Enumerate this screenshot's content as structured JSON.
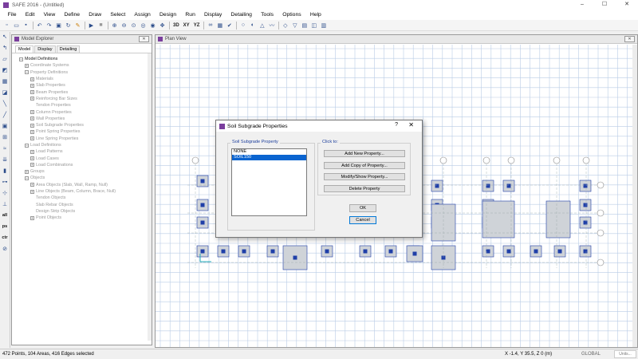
{
  "window": {
    "title": "SAFE 2016 - (Untitled)",
    "controls": [
      "–",
      "☐",
      "✕"
    ]
  },
  "menu": [
    "File",
    "Edit",
    "View",
    "Define",
    "Draw",
    "Select",
    "Assign",
    "Design",
    "Run",
    "Display",
    "Detailing",
    "Tools",
    "Options",
    "Help"
  ],
  "toolbar": {
    "icons": [
      "new-file-icon",
      "open-folder-icon",
      "save-icon",
      "undo-icon",
      "redo-icon",
      "lock-icon",
      "refresh-icon",
      "pencil-icon",
      "run-icon",
      "stop-icon",
      "zoom-in-icon",
      "zoom-out-icon",
      "zoom-window-icon",
      "zoom-prev-icon",
      "zoom-fit-icon",
      "pan-icon",
      "move-icon",
      "binoculars-icon",
      "view-icon",
      "check-icon",
      "circle-icon",
      "rotate-icon",
      "warning-icon",
      "deformed-icon",
      "shape-icon",
      "filter-icon",
      "grid-icon",
      "reset-icon",
      "table-icon"
    ],
    "view_labels": [
      "3D",
      "XY",
      "YZ"
    ]
  },
  "left_tools": [
    "pointer",
    "reshape",
    "area",
    "slab",
    "drop-panel",
    "opening",
    "beam",
    "line",
    "column",
    "point",
    "spring",
    "load",
    "wall",
    "design-strip",
    "zoom",
    "all",
    "ps",
    "ctr",
    "clear"
  ],
  "left_tool_labels": {
    "all": "all",
    "ps": "ps",
    "ctr": "ctr"
  },
  "explorer": {
    "title": "Model Explorer",
    "tabs": [
      "Model",
      "Display",
      "Detailing"
    ],
    "tree": [
      {
        "label": "Model Definitions",
        "level": 0,
        "exp": "−",
        "strong": true
      },
      {
        "label": "Coordinate Systems",
        "level": 1,
        "exp": "+"
      },
      {
        "label": "Property Definitions",
        "level": 1,
        "exp": "−"
      },
      {
        "label": "Materials",
        "level": 2,
        "exp": "+"
      },
      {
        "label": "Slab Properties",
        "level": 2,
        "exp": "+"
      },
      {
        "label": "Beam Properties",
        "level": 2,
        "exp": "+"
      },
      {
        "label": "Reinforcing Bar Sizes",
        "level": 2,
        "exp": "+"
      },
      {
        "label": "Tendon Properties",
        "level": 2,
        "exp": ""
      },
      {
        "label": "Column Properties",
        "level": 2,
        "exp": "+"
      },
      {
        "label": "Wall Properties",
        "level": 2,
        "exp": "+"
      },
      {
        "label": "Soil Subgrade Properties",
        "level": 2,
        "exp": "+"
      },
      {
        "label": "Point Spring Properties",
        "level": 2,
        "exp": "+"
      },
      {
        "label": "Line Spring Properties",
        "level": 2,
        "exp": "+"
      },
      {
        "label": "Load Definitions",
        "level": 1,
        "exp": "−"
      },
      {
        "label": "Load Patterns",
        "level": 2,
        "exp": "+"
      },
      {
        "label": "Load Cases",
        "level": 2,
        "exp": "+"
      },
      {
        "label": "Load Combinations",
        "level": 2,
        "exp": "+"
      },
      {
        "label": "Groups",
        "level": 1,
        "exp": "+"
      },
      {
        "label": "Objects",
        "level": 1,
        "exp": "−"
      },
      {
        "label": "Area Objects (Slab, Wall, Ramp, Null)",
        "level": 2,
        "exp": "+"
      },
      {
        "label": "Line Objects (Beam, Column, Brace, Null)",
        "level": 2,
        "exp": "+"
      },
      {
        "label": "Tendon Objects",
        "level": 2,
        "exp": ""
      },
      {
        "label": "Slab Rebar Objects",
        "level": 2,
        "exp": ""
      },
      {
        "label": "Design Strip Objects",
        "level": 2,
        "exp": ""
      },
      {
        "label": "Point Objects",
        "level": 2,
        "exp": "+"
      }
    ]
  },
  "plan_view": {
    "title": "Plan View",
    "grid_bubbles_top": [
      "A",
      "B",
      "C",
      "D",
      "E",
      "F"
    ],
    "grid_bubbles_right": [
      "1",
      "2",
      "3",
      "4"
    ]
  },
  "dialog": {
    "title": "Soil Subgrade Properties",
    "help": "?",
    "close": "✕",
    "list_group_label": "Soil Subgrade Property",
    "list_items": [
      "NONE",
      "SOIL150"
    ],
    "selected_item": "SOIL150",
    "click_group_label": "Click to:",
    "buttons": {
      "add_new": "Add New Property...",
      "add_copy": "Add Copy of Property...",
      "modify": "Modify/Show Property...",
      "delete": "Delete Property",
      "ok": "OK",
      "cancel": "Cancel"
    }
  },
  "status": {
    "selection": "472 Points, 104 Areas, 416 Edges selected",
    "coords": "X -1.4,  Y 35.5,  Z 0   (m)",
    "units": "GLOBAL",
    "units_dropdown": "Units..."
  },
  "colors": {
    "accent": "#7a3e9d",
    "grid": "#b9cce6",
    "footing_fill": "#cfd3d8",
    "point": "#1f3fa8",
    "selection": "#0a64d0"
  }
}
